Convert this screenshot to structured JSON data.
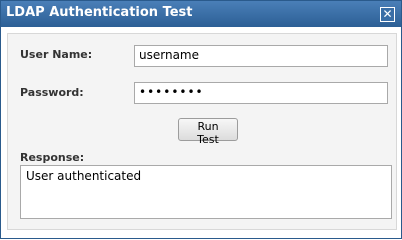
{
  "dialog": {
    "title": "LDAP Authentication Test",
    "close_icon": "close-icon"
  },
  "form": {
    "username_label": "User Name:",
    "username_value": "username",
    "password_label": "Password:",
    "password_value": "••••••••",
    "run_button_label": "Run Test",
    "response_label": "Response:",
    "response_value": "User authenticated"
  },
  "colors": {
    "titlebar": "#2e6096",
    "panel": "#f4f4f4"
  }
}
